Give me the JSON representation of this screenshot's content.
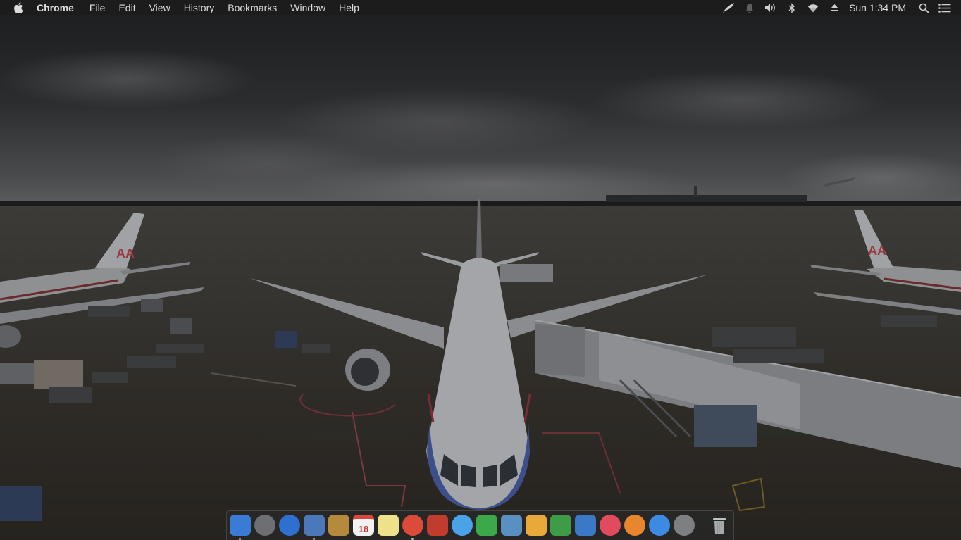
{
  "menubar": {
    "apple_icon": "apple-logo-icon",
    "app_name": "Chrome",
    "menus": [
      "File",
      "Edit",
      "View",
      "History",
      "Bookmarks",
      "Window",
      "Help"
    ],
    "status_icons": [
      "feather-icon",
      "notification-bell-icon",
      "volume-icon",
      "bluetooth-icon",
      "wifi-icon",
      "eject-icon"
    ],
    "clock": "Sun 1:34 PM",
    "right_icons": [
      "spotlight-search-icon",
      "notification-center-icon"
    ]
  },
  "dock": {
    "apps": [
      {
        "name": "finder-icon",
        "color": "#3a7bd5",
        "running": true
      },
      {
        "name": "launchpad-icon",
        "color": "#6d6f73",
        "running": false
      },
      {
        "name": "safari-icon",
        "color": "#2f6fd0",
        "running": false
      },
      {
        "name": "preview-icon",
        "color": "#4a78b8",
        "running": true
      },
      {
        "name": "contacts-icon",
        "color": "#b58a3c",
        "running": false
      },
      {
        "name": "calendar-icon",
        "color": "#f2f2f2",
        "running": false,
        "label": "18"
      },
      {
        "name": "notes-icon",
        "color": "#efe08a",
        "running": false
      },
      {
        "name": "chrome-icon",
        "color": "#dc4a3a",
        "running": true
      },
      {
        "name": "photo-booth-icon",
        "color": "#c23b2f",
        "running": false
      },
      {
        "name": "messages-icon",
        "color": "#4aa3e6",
        "running": false
      },
      {
        "name": "facetime-icon",
        "color": "#3ba84a",
        "running": false
      },
      {
        "name": "iphoto-icon",
        "color": "#5a8fc2",
        "running": false
      },
      {
        "name": "pages-icon",
        "color": "#e8a83a",
        "running": false
      },
      {
        "name": "numbers-icon",
        "color": "#3f9b48",
        "running": false
      },
      {
        "name": "keynote-icon",
        "color": "#3b78c6",
        "running": false
      },
      {
        "name": "itunes-icon",
        "color": "#e24b5e",
        "running": false
      },
      {
        "name": "ibooks-icon",
        "color": "#e8862e",
        "running": false
      },
      {
        "name": "app-store-icon",
        "color": "#3d8ae3",
        "running": false
      },
      {
        "name": "system-preferences-icon",
        "color": "#7d7f83",
        "running": false
      }
    ],
    "trash": {
      "name": "trash-icon",
      "color": "#bfc3c7"
    }
  },
  "wallpaper": {
    "name": "airport-tarmac-wallpaper",
    "sky_color": "#2b2c2e",
    "ground_color": "#35332f"
  }
}
